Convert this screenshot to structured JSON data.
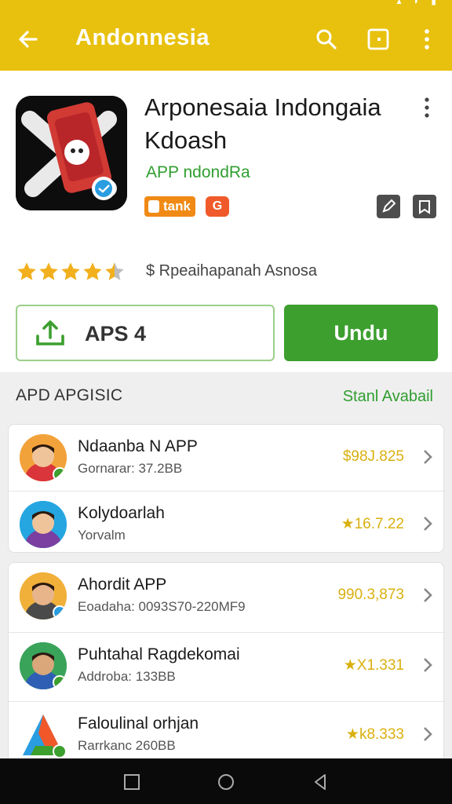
{
  "app_bar": {
    "title": "Andonnesia",
    "background": "#e8c10e"
  },
  "detail": {
    "app_name": "Arponesaia Indongaia Kdoash",
    "developer": "APP ndondRa",
    "badge_label": "tank",
    "badge_icon_text": "G",
    "rating_stars": 4.5,
    "rating_text": "$ Rpeaihapanah Asnosa",
    "open_button_label": "APS 4",
    "install_button_label": "Undu"
  },
  "section": {
    "title": "APD APGISIC",
    "link": "Stanl Avabail"
  },
  "list_group_1": [
    {
      "title": "Ndaanba N APP",
      "subtitle": "Gornarar: 37.2BB",
      "value": "$98J.825"
    },
    {
      "title": "Kolydoarlah",
      "subtitle": "Yorvalm",
      "value": "★16.7.22"
    }
  ],
  "list_group_2": [
    {
      "title": "Ahordit APP",
      "subtitle": "Eoadaha: 0093S70-220MF9",
      "value": "990.3,873"
    },
    {
      "title": "Puhtahal Ragdekomai",
      "subtitle": "Addroba: 133BB",
      "value": "★X1.331"
    },
    {
      "title": "Faloulinal orhjan",
      "subtitle": "Rarrkanc 260BB",
      "value": "★k8.333"
    }
  ],
  "colors": {
    "accent": "#e8c10e",
    "primary_green": "#3c9f2e",
    "value_gold": "#d9b010"
  }
}
